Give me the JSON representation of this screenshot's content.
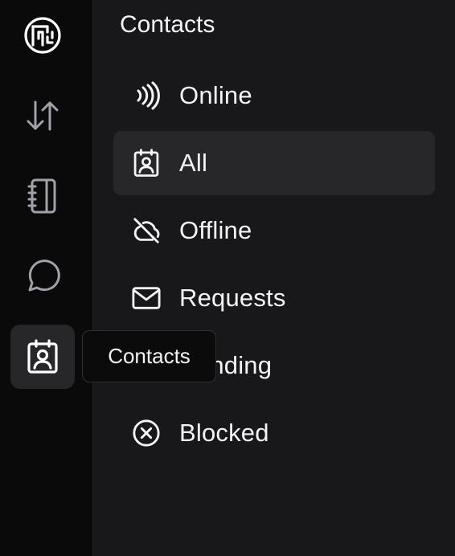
{
  "rail": {
    "items": [
      {
        "name": "logo",
        "icon": "circuit-logo-icon"
      },
      {
        "name": "transfers",
        "icon": "arrows-up-down-icon"
      },
      {
        "name": "notebook",
        "icon": "notebook-icon"
      },
      {
        "name": "chat",
        "icon": "chat-bubble-icon"
      },
      {
        "name": "contacts",
        "icon": "contact-card-icon",
        "active": true
      }
    ]
  },
  "tooltip": {
    "text": "Contacts"
  },
  "panel": {
    "title": "Contacts",
    "items": [
      {
        "label": "Online",
        "icon": "signal-waves-icon"
      },
      {
        "label": "All",
        "icon": "contact-card-icon",
        "selected": true
      },
      {
        "label": "Offline",
        "icon": "cloud-off-icon"
      },
      {
        "label": "Requests",
        "icon": "mail-icon"
      },
      {
        "label": "Pending",
        "icon": "hourglass-icon"
      },
      {
        "label": "Blocked",
        "icon": "x-circle-icon"
      }
    ]
  },
  "colors": {
    "rail_bg": "#0a0a0b",
    "panel_bg": "#18181b",
    "selected_bg": "#27272a",
    "text": "#f4f4f5",
    "muted_icon": "#a1a1aa"
  }
}
